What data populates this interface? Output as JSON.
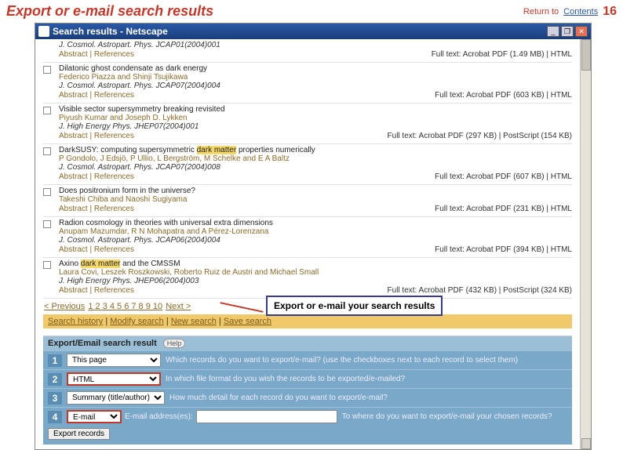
{
  "slide": {
    "title": "Export or e-mail search results",
    "return_label": "Return to",
    "contents_link": "Contents",
    "page_number": "16"
  },
  "window": {
    "title": "Search results - Netscape",
    "min": "_",
    "max": "❐",
    "close": "✕"
  },
  "results": [
    {
      "title_prefix": "J. Cosmol. Astropart. Phys. JCAP01(2004)001",
      "authors_html": "",
      "journal": "",
      "links": "Abstract | References",
      "fulltext": "Full text: Acrobat PDF (1.49 MB) | HTML"
    },
    {
      "title_prefix": "Dilatonic ghost condensate as dark energy",
      "authors_html": "Federico Piazza and Shinji Tsujikawa",
      "journal": "J. Cosmol. Astropart. Phys. JCAP07(2004)004",
      "links": "Abstract | References",
      "fulltext": "Full text: Acrobat PDF (603 KB) | HTML"
    },
    {
      "title_prefix": "Visible sector supersymmetry breaking revisited",
      "authors_html": "Piyush Kumar and Joseph D. Lykken",
      "journal": "J. High Energy Phys. JHEP07(2004)001",
      "links": "Abstract | References",
      "fulltext": "Full text: Acrobat PDF (297 KB) | PostScript (154 KB)"
    },
    {
      "title_prefix_pre": "DarkSUSY: computing supersymmetric ",
      "title_hl": "dark matter",
      "title_prefix_post": " properties numerically",
      "authors_html": "P Gondolo, J Edsjö, P Ullio, L Bergström, M Schelke and E A Baltz",
      "journal": "J. Cosmol. Astropart. Phys. JCAP07(2004)008",
      "links": "Abstract | References",
      "fulltext": "Full text: Acrobat PDF (607 KB) | HTML"
    },
    {
      "title_prefix": "Does positronium form in the universe?",
      "authors_html": "Takeshi Chiba and Naoshi Sugiyama",
      "journal": "",
      "links": "Abstract | References",
      "fulltext": "Full text: Acrobat PDF (231 KB) | HTML"
    },
    {
      "title_prefix": "Radion cosmology in theories with universal extra dimensions",
      "authors_html": "Anupam Mazumdar, R N Mohapatra and A Pérez-Lorenzana",
      "journal": "J. Cosmol. Astropart. Phys. JCAP06(2004)004",
      "links": "Abstract | References",
      "fulltext": "Full text: Acrobat PDF (394 KB) | HTML"
    },
    {
      "title_prefix_pre": "Axino ",
      "title_hl": "dark matter",
      "title_prefix_post": " and the CMSSM",
      "authors_html": "Laura Covi, Leszek Roszkowski, Roberto Ruiz de Austri and Michael Small",
      "journal": "J. High Energy Phys. JHEP06(2004)003",
      "links": "Abstract | References",
      "fulltext": "Full text: Acrobat PDF (432 KB) | PostScript (324 KB)"
    }
  ],
  "pager": {
    "prev": "< Previous",
    "pages": "1 2 3 4 5 6 7 8 9 10",
    "next": "Next >"
  },
  "callout": "Export or e-mail your search results",
  "search_actions": {
    "history": "Search history",
    "modify": "Modify search",
    "new": "New search",
    "save": "Save search"
  },
  "export": {
    "header": "Export/Email search result",
    "help": "Help",
    "step1_select": "This page",
    "step1_text": "Which records do you want to export/e-mail? (use the checkboxes next to each record to select them)",
    "step2_select": "HTML",
    "step2_text": "In which file format do you wish the records to be exported/e-mailed?",
    "step3_select": "Summary (title/author)",
    "step3_text": "How much detail for each record do you want to export/e-mail?",
    "step4_select": "E-mail",
    "step4_label": "E-mail address(es):",
    "step4_text": "To where do you want to export/e-mail your chosen records?",
    "go": "Export records"
  }
}
